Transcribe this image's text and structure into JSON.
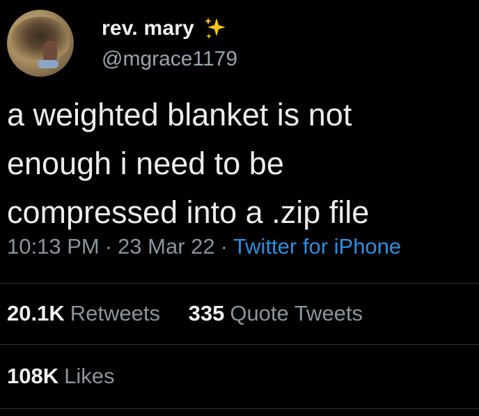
{
  "user": {
    "display_name": "rev. mary",
    "handle": "@mgrace1179",
    "badge_icon": "sparkles-icon",
    "avatar_icon": "profile-photo"
  },
  "tweet": {
    "text": "a weighted blanket is not\nenough i need to be\ncompressed into a .zip file"
  },
  "meta": {
    "time": "10:13 PM",
    "separator": "·",
    "date": "23 Mar 22",
    "source": "Twitter for iPhone"
  },
  "stats": {
    "retweets_count": "20.1K",
    "retweets_label": "Retweets",
    "quotes_count": "335",
    "quotes_label": "Quote Tweets",
    "likes_count": "108K",
    "likes_label": "Likes"
  },
  "colors": {
    "background": "#000000",
    "text": "#ececec",
    "muted": "#8b949c",
    "link": "#2d8ee0",
    "sparkle": "#f5c518",
    "divider": "#2f3336"
  }
}
